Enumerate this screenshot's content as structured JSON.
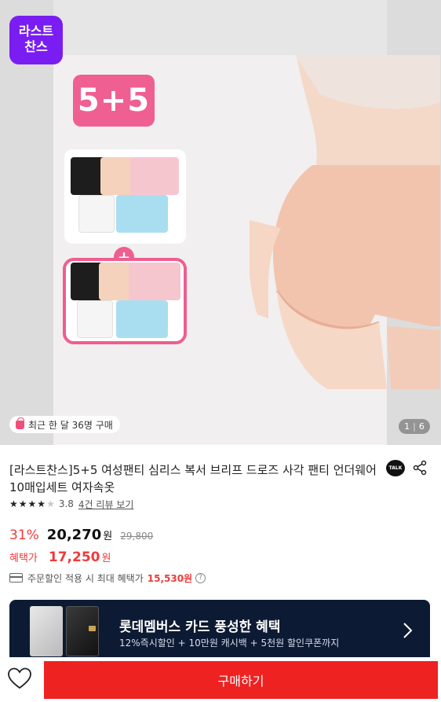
{
  "hero": {
    "brand_logo_lines": [
      "라스트",
      "찬스"
    ],
    "badge": "5+5",
    "plus": "+",
    "recent_purchase": "최근 한 달 36명 구매",
    "page_current": "1",
    "page_total": "6"
  },
  "product": {
    "title": "[라스트찬스]5+5 여성팬티 심리스 복서 브리프 드로즈 사각 팬티 언더웨어 10매입세트 여자속옷",
    "talk_label": "TALK",
    "rating": "3.8",
    "stars_filled": 4,
    "review_link": "4건 리뷰 보기",
    "discount": "31%",
    "price": "20,270",
    "won": "원",
    "original_price": "29,800",
    "benefit_label": "혜택가",
    "benefit_price": "17,250",
    "coupon_text": "주문할인 적용 시 최대 혜택가",
    "coupon_amount": "15,530원"
  },
  "banner": {
    "title": "롯데멤버스 카드 풍성한 혜택",
    "subtitle": "12%즉시할인 + 10만원 캐시백 + 5천원 할인쿠폰까지"
  },
  "bottom": {
    "buy_label": "구매하기"
  },
  "colors": {
    "accent_red": "#ef2222",
    "discount_red": "#f03a3a",
    "brand_purple": "#7a1df2",
    "badge_pink": "#ef5f92",
    "banner_navy": "#0d1a33"
  },
  "icons": [
    "brand-logo",
    "bag-icon",
    "talk-icon",
    "share-icon",
    "star-icon",
    "card-icon",
    "help-icon",
    "chevron-right-icon",
    "heart-icon"
  ]
}
